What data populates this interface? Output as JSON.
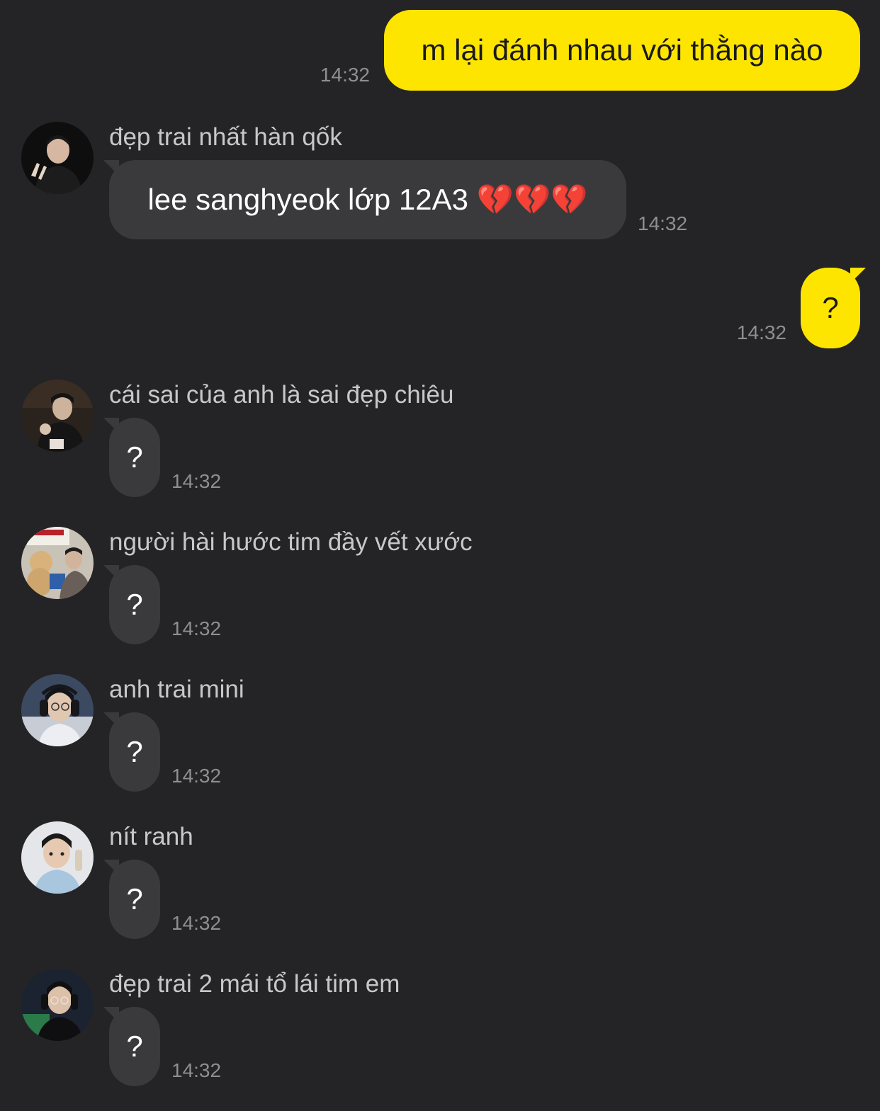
{
  "colors": {
    "background": "#242426",
    "outgoing_bubble": "#fee500",
    "incoming_bubble": "#3a3a3c",
    "timestamp": "#8e8e93"
  },
  "messages": [
    {
      "type": "outgoing",
      "text": "m lại đánh nhau với thằng nào",
      "time": "14:32"
    },
    {
      "type": "incoming",
      "sender": "đẹp trai nhất hàn qốk",
      "avatar": "avatar-photo",
      "text": "lee sanghyeok lớp 12A3 💔💔💔",
      "time": "14:32"
    },
    {
      "type": "outgoing",
      "text": "?",
      "time": "14:32"
    },
    {
      "type": "incoming",
      "sender": "cái sai của anh là sai đẹp chiêu",
      "avatar": "avatar-photo",
      "text": "?",
      "time": "14:32"
    },
    {
      "type": "incoming",
      "sender": "người hài hước tim đầy vết xước",
      "avatar": "avatar-photo",
      "text": "?",
      "time": "14:32"
    },
    {
      "type": "incoming",
      "sender": "anh trai mini",
      "avatar": "avatar-photo",
      "text": "?",
      "time": "14:32"
    },
    {
      "type": "incoming",
      "sender": "nít ranh",
      "avatar": "avatar-photo",
      "text": "?",
      "time": "14:32"
    },
    {
      "type": "incoming",
      "sender": "đẹp trai 2 mái tổ lái tim em",
      "avatar": "avatar-photo",
      "text": "?",
      "time": "14:32"
    }
  ]
}
